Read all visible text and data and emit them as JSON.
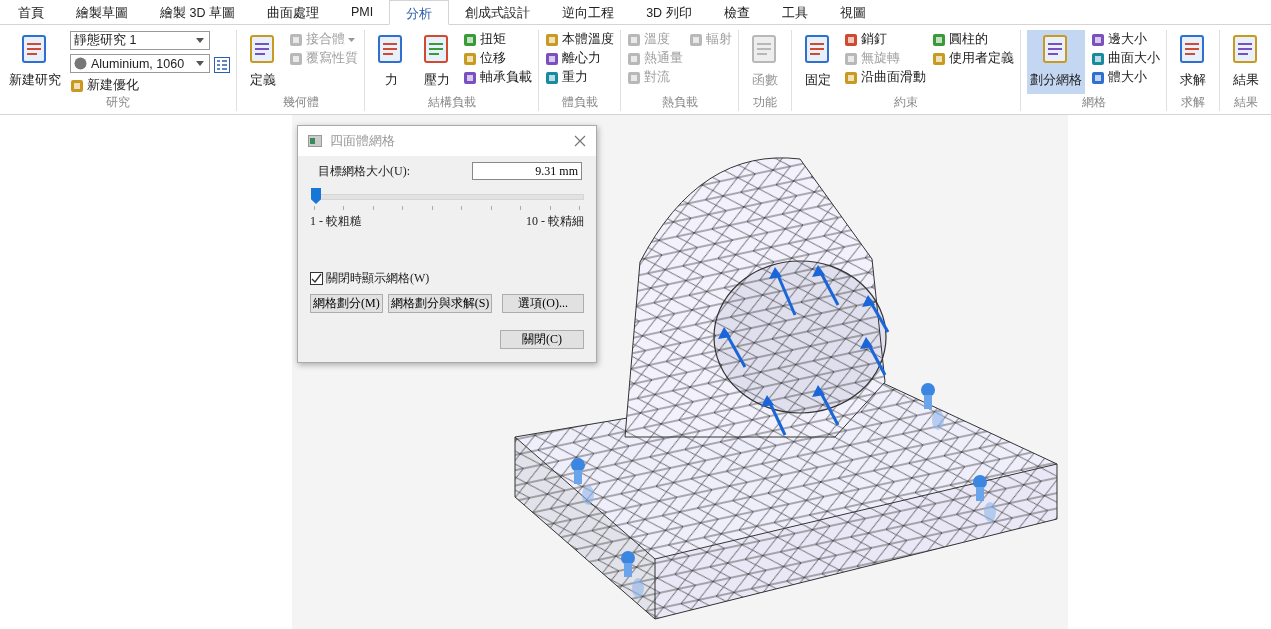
{
  "tabs": [
    {
      "label": "首頁",
      "selected": false
    },
    {
      "label": "繪製草圖",
      "selected": false
    },
    {
      "label": "繪製 3D 草圖",
      "selected": false
    },
    {
      "label": "曲面處理",
      "selected": false
    },
    {
      "label": "PMI",
      "selected": false
    },
    {
      "label": "分析",
      "selected": true
    },
    {
      "label": "創成式設計",
      "selected": false
    },
    {
      "label": "逆向工程",
      "selected": false
    },
    {
      "label": "3D 列印",
      "selected": false
    },
    {
      "label": "檢查",
      "selected": false
    },
    {
      "label": "工具",
      "selected": false
    },
    {
      "label": "視圖",
      "selected": false
    }
  ],
  "ribbon": {
    "groups": [
      {
        "label": "研究",
        "items": [
          {
            "kind": "large",
            "label": "新建研究",
            "disabled": false,
            "active": false
          },
          {
            "kind": "column",
            "entries": [
              {
                "kind": "combo",
                "label": "靜態研究 1"
              },
              {
                "kind": "combo-button",
                "label": "Aluminium, 1060"
              },
              {
                "kind": "small",
                "label": "新建優化",
                "disabled": false,
                "menu": false
              }
            ]
          }
        ]
      },
      {
        "label": "幾何體",
        "items": [
          {
            "kind": "large",
            "label": "定義",
            "disabled": false,
            "active": false
          },
          {
            "kind": "column",
            "entries": [
              {
                "kind": "small",
                "label": "接合體",
                "disabled": true,
                "menu": true
              },
              {
                "kind": "small",
                "label": "覆寫性質",
                "disabled": true,
                "menu": false
              }
            ]
          }
        ]
      },
      {
        "label": "結構負載",
        "items": [
          {
            "kind": "large",
            "label": "力",
            "disabled": false,
            "active": false
          },
          {
            "kind": "large",
            "label": "壓力",
            "disabled": false,
            "active": false
          },
          {
            "kind": "column",
            "entries": [
              {
                "kind": "small",
                "label": "扭矩",
                "disabled": false,
                "menu": false
              },
              {
                "kind": "small",
                "label": "位移",
                "disabled": false,
                "menu": false
              },
              {
                "kind": "small",
                "label": "軸承負載",
                "disabled": false,
                "menu": false
              }
            ]
          }
        ]
      },
      {
        "label": "體負載",
        "items": [
          {
            "kind": "column",
            "entries": [
              {
                "kind": "small",
                "label": "本體溫度",
                "disabled": false,
                "menu": false
              },
              {
                "kind": "small",
                "label": "離心力",
                "disabled": false,
                "menu": false
              },
              {
                "kind": "small",
                "label": "重力",
                "disabled": false,
                "menu": false
              }
            ]
          }
        ]
      },
      {
        "label": "熱負載",
        "items": [
          {
            "kind": "column",
            "entries": [
              {
                "kind": "small",
                "label": "溫度",
                "disabled": true,
                "menu": false
              },
              {
                "kind": "small",
                "label": "熱通量",
                "disabled": true,
                "menu": false
              },
              {
                "kind": "small",
                "label": "對流",
                "disabled": true,
                "menu": false
              }
            ]
          },
          {
            "kind": "column",
            "entries": [
              {
                "kind": "small",
                "label": "輻射",
                "disabled": true,
                "menu": false
              }
            ]
          }
        ]
      },
      {
        "label": "功能",
        "items": [
          {
            "kind": "large",
            "label": "函數",
            "disabled": true,
            "active": false
          }
        ]
      },
      {
        "label": "約束",
        "items": [
          {
            "kind": "large",
            "label": "固定",
            "disabled": false,
            "active": false
          },
          {
            "kind": "column",
            "entries": [
              {
                "kind": "small",
                "label": "銷釘",
                "disabled": false,
                "menu": false
              },
              {
                "kind": "small",
                "label": "無旋轉",
                "disabled": true,
                "menu": false
              },
              {
                "kind": "small",
                "label": "沿曲面滑動",
                "disabled": false,
                "menu": false
              }
            ]
          },
          {
            "kind": "column",
            "entries": [
              {
                "kind": "small",
                "label": "圓柱的",
                "disabled": false,
                "menu": false
              },
              {
                "kind": "small",
                "label": "使用者定義",
                "disabled": false,
                "menu": false
              }
            ]
          }
        ]
      },
      {
        "label": "網格",
        "items": [
          {
            "kind": "large",
            "label": "劃分網格",
            "disabled": false,
            "active": true
          },
          {
            "kind": "column",
            "entries": [
              {
                "kind": "small",
                "label": "邊大小",
                "disabled": false,
                "menu": false
              },
              {
                "kind": "small",
                "label": "曲面大小",
                "disabled": false,
                "menu": false
              },
              {
                "kind": "small",
                "label": "體大小",
                "disabled": false,
                "menu": false
              }
            ]
          }
        ]
      },
      {
        "label": "求解",
        "items": [
          {
            "kind": "large",
            "label": "求解",
            "disabled": false,
            "active": false
          }
        ]
      },
      {
        "label": "結果",
        "items": [
          {
            "kind": "large",
            "label": "結果",
            "disabled": false,
            "active": false
          }
        ]
      }
    ]
  },
  "dialog": {
    "title": "四面體網格",
    "size_label": "目標網格大小(U):",
    "size_value": "9.31 mm",
    "slider": {
      "level": 0,
      "min_label": "1 - 較粗糙",
      "max_label": "10 - 較精細"
    },
    "show_mesh": {
      "label": "關閉時顯示網格(W)",
      "checked": true
    },
    "buttons": [
      "網格劃分(M)",
      "網格劃分與求解(S)",
      "選項(O)..."
    ],
    "close_button": "關閉(C)"
  }
}
